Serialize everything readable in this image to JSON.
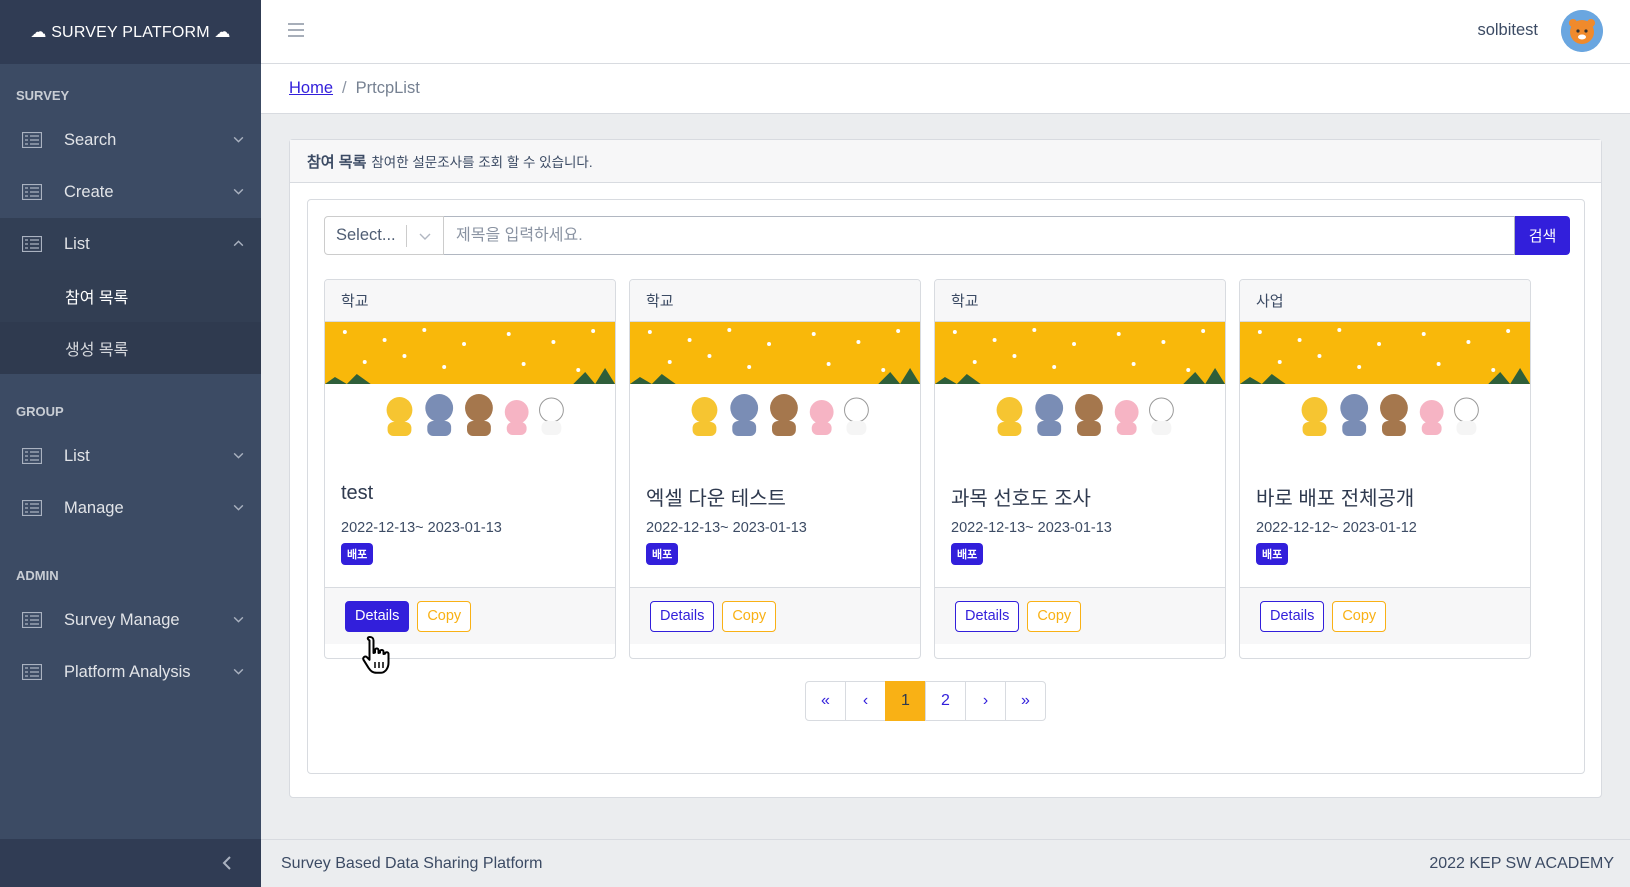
{
  "sidebar": {
    "brand": "☁ SURVEY PLATFORM ☁",
    "sections": [
      {
        "title": "SURVEY"
      },
      {
        "title": "GROUP"
      },
      {
        "title": "ADMIN"
      }
    ],
    "survey_items": [
      {
        "label": "Search"
      },
      {
        "label": "Create"
      },
      {
        "label": "List"
      }
    ],
    "list_sub": [
      {
        "label": "참여 목록"
      },
      {
        "label": "생성 목록"
      }
    ],
    "group_items": [
      {
        "label": "List"
      },
      {
        "label": "Manage"
      }
    ],
    "admin_items": [
      {
        "label": "Survey Manage"
      },
      {
        "label": "Platform Analysis"
      }
    ]
  },
  "header": {
    "username": "solbitest"
  },
  "breadcrumb": {
    "home": "Home",
    "separator": "/",
    "current": "PrtcpList"
  },
  "page": {
    "title": "참여 목록",
    "subtitle": "참여한 설문조사를 조회 할 수 있습니다.",
    "select_value": "Select...",
    "search_placeholder": "제목을 입력하세요.",
    "search_button": "검색"
  },
  "cards": [
    {
      "category": "학교",
      "title": "test",
      "date": "2022-12-13~ 2023-01-13",
      "badge": "배포",
      "details": "Details",
      "copy": "Copy"
    },
    {
      "category": "학교",
      "title": "엑셀 다운 테스트",
      "date": "2022-12-13~ 2023-01-13",
      "badge": "배포",
      "details": "Details",
      "copy": "Copy"
    },
    {
      "category": "학교",
      "title": "과목 선호도 조사",
      "date": "2022-12-13~ 2023-01-13",
      "badge": "배포",
      "details": "Details",
      "copy": "Copy"
    },
    {
      "category": "사업",
      "title": "바로 배포 전체공개",
      "date": "2022-12-12~ 2023-01-12",
      "badge": "배포",
      "details": "Details",
      "copy": "Copy"
    }
  ],
  "pagination": {
    "first": "«",
    "prev": "‹",
    "pages": [
      "1",
      "2"
    ],
    "current_page": "1",
    "next": "›",
    "last": "»"
  },
  "footer": {
    "left": "Survey Based Data Sharing Platform",
    "right": "2022 KEP SW ACADEMY"
  },
  "colors": {
    "sidebar_bg": "#3c4b64",
    "primary": "#321fdb",
    "warning": "#f9b115",
    "banner": "#f9b80a"
  },
  "icons": [
    "cloud-icon",
    "list-icon",
    "chevron-down-icon",
    "chevron-up-icon",
    "hamburger-icon",
    "avatar-icon",
    "chevron-left-icon",
    "hand-cursor-icon"
  ]
}
